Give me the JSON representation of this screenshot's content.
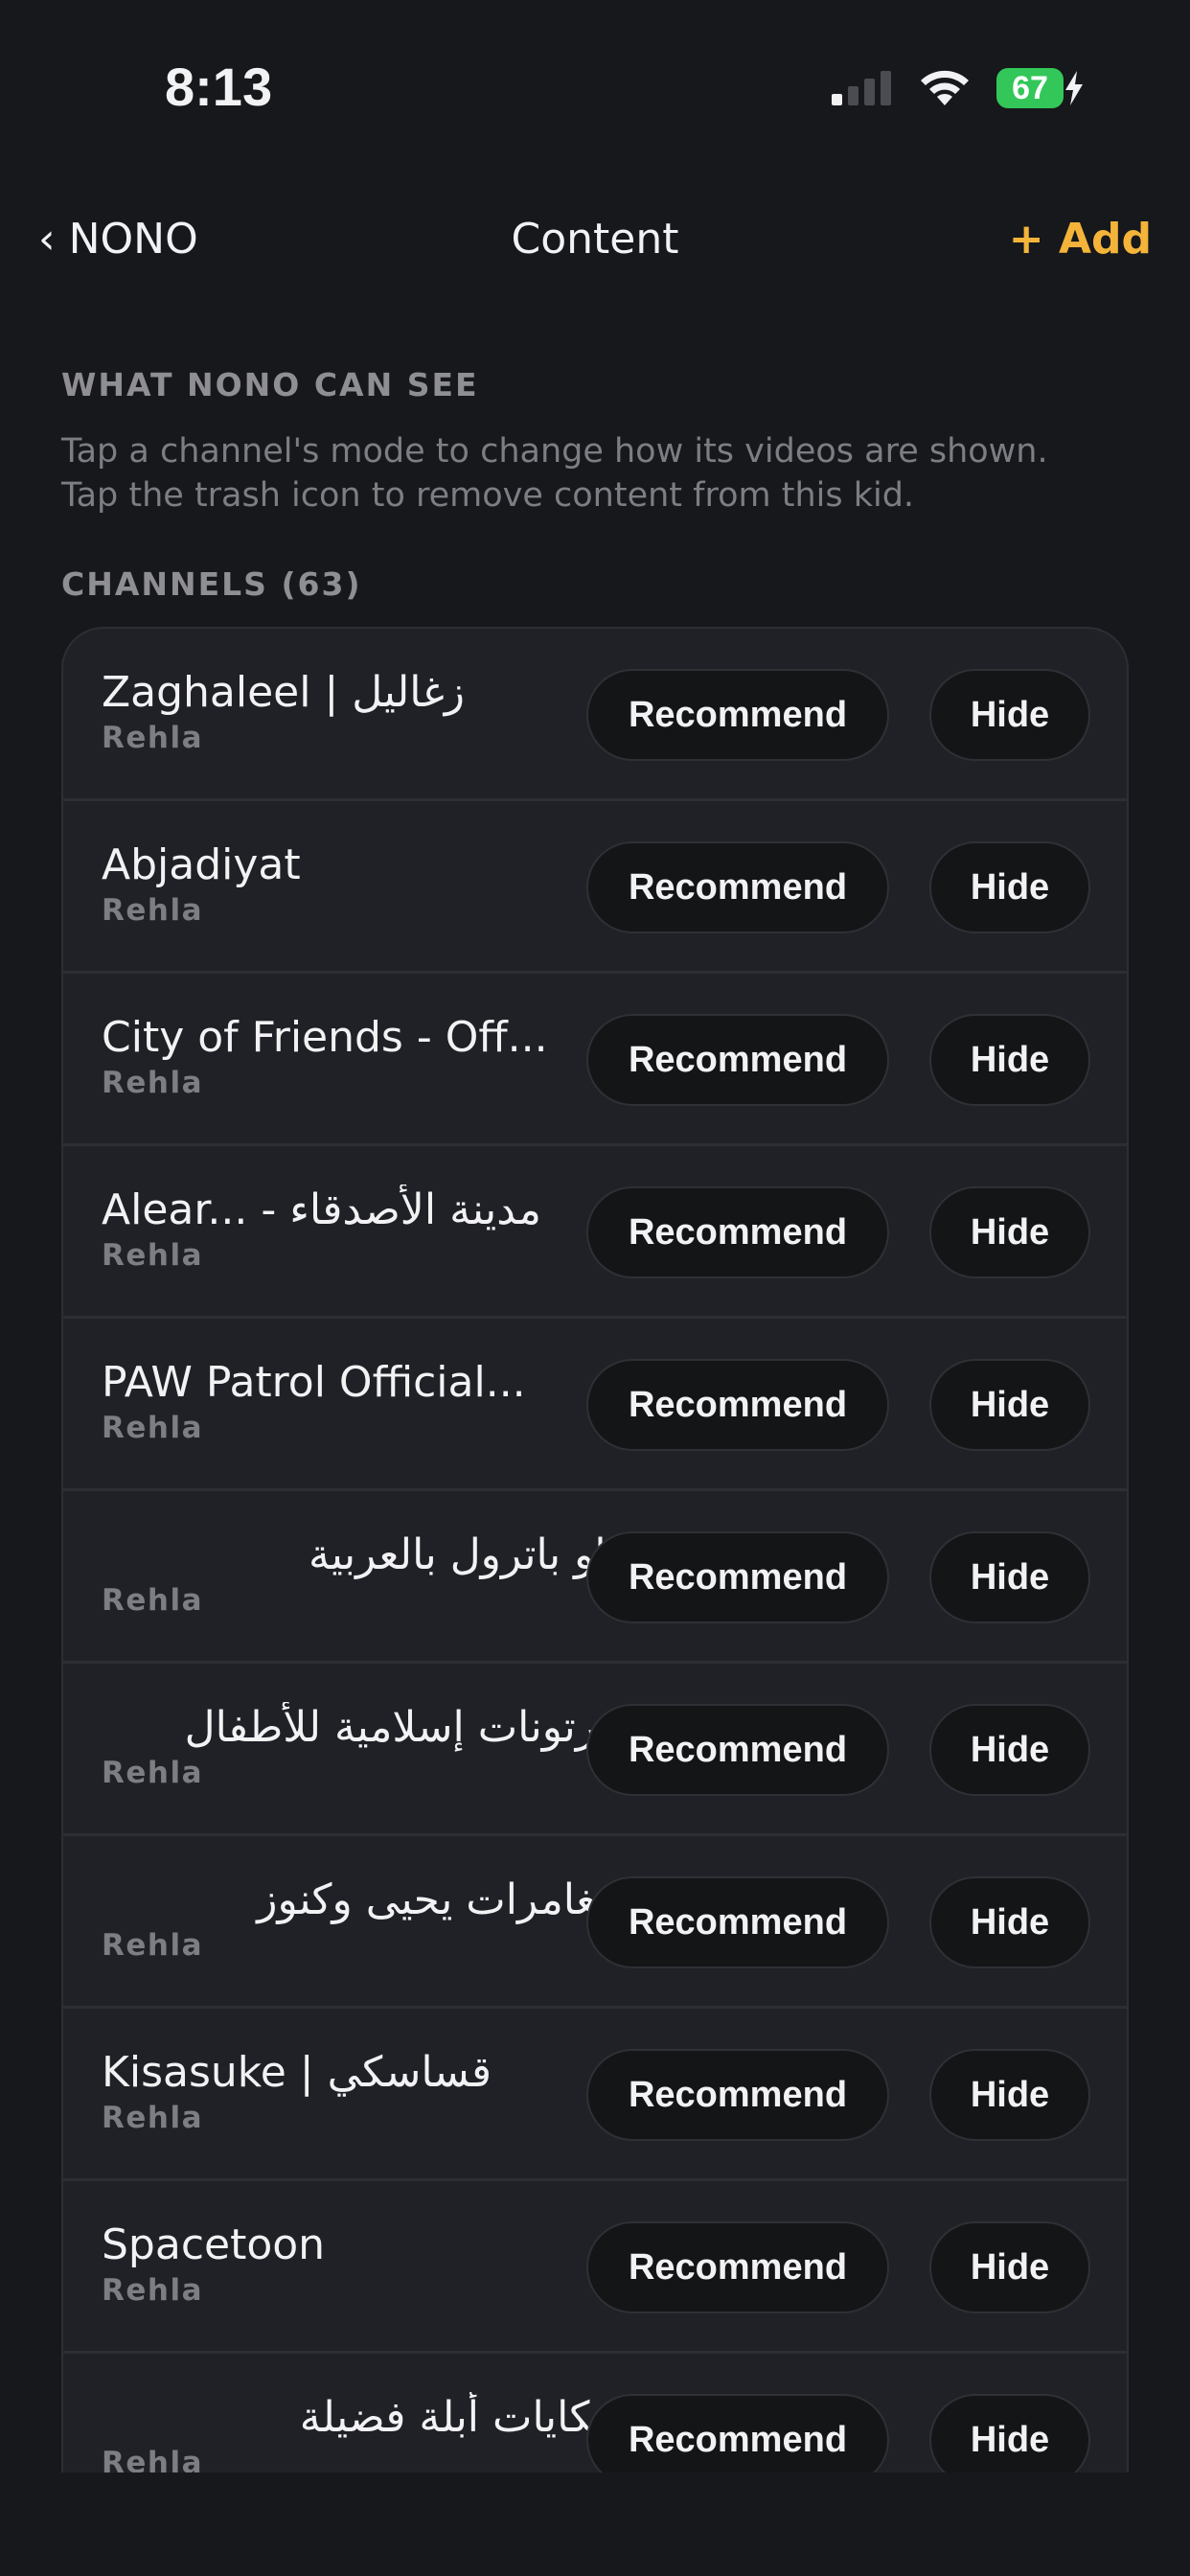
{
  "status_bar": {
    "time": "8:13",
    "battery_level": "67",
    "battery_color": "#33c759",
    "icons": [
      "cellular-signal-icon",
      "wifi-icon",
      "battery-icon",
      "charging-bolt-icon"
    ]
  },
  "nav": {
    "back_label": "NONO",
    "title": "Content",
    "add_label": "+ Add",
    "accent_color": "#f4b43a"
  },
  "section": {
    "header": "WHAT NONO CAN SEE",
    "help_line_1": "Tap a channel's mode to change how its videos are shown.",
    "help_line_2": "Tap the trash icon to remove content from this kid."
  },
  "channels": {
    "header": "CHANNELS (63)",
    "recommend_label": "Recommend",
    "hide_label": "Hide",
    "items": [
      {
        "name": "Zaghaleel | زغاليل",
        "source": "Rehla"
      },
      {
        "name": "Abjadiyat",
        "source": "Rehla"
      },
      {
        "name": "City of Friends - Off...",
        "source": "Rehla"
      },
      {
        "name": "Alear... - مدينة الأصدقاء",
        "source": "Rehla"
      },
      {
        "name": "PAW Patrol Official...",
        "source": "Rehla"
      },
      {
        "name": "باو باترول بالعربية",
        "source": "Rehla"
      },
      {
        "name": "كرتونات إسلامية للأطفال",
        "source": "Rehla"
      },
      {
        "name": "مغامرات يحيى وكنوز",
        "source": "Rehla"
      },
      {
        "name": "Kisasuke | قساسكي",
        "source": "Rehla"
      },
      {
        "name": "Spacetoon",
        "source": "Rehla"
      },
      {
        "name": "حكايات أبلة فضيلة",
        "source": "Rehla"
      }
    ]
  }
}
